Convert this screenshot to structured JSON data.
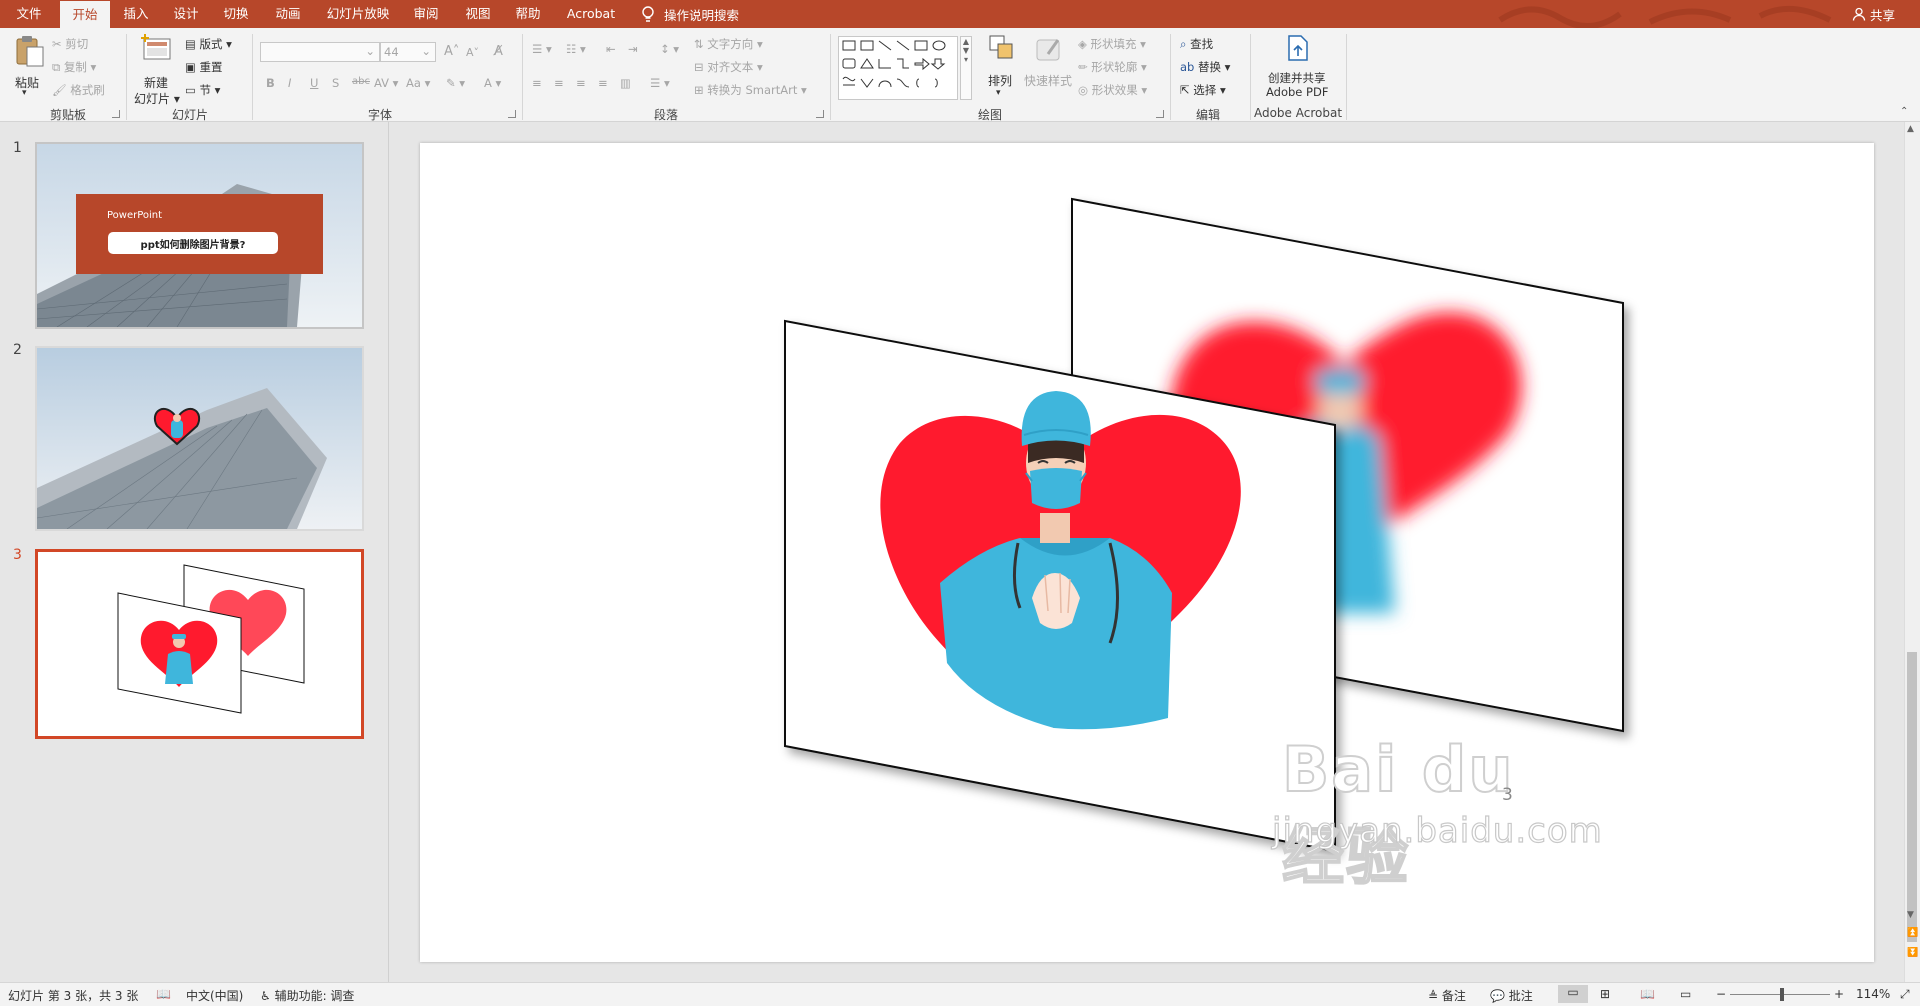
{
  "tabs": [
    "文件",
    "开始",
    "插入",
    "设计",
    "切换",
    "动画",
    "幻灯片放映",
    "审阅",
    "视图",
    "帮助",
    "Acrobat"
  ],
  "tell_me": "操作说明搜索",
  "share": "共享",
  "ribbon": {
    "clipboard": {
      "paste": "粘贴",
      "cut": "剪切",
      "copy": "复制",
      "format_painter": "格式刷",
      "label": "剪贴板"
    },
    "slides": {
      "new_slide": "新建",
      "new_slide2": "幻灯片",
      "layout": "版式",
      "reset": "重置",
      "section": "节",
      "label": "幻灯片"
    },
    "font": {
      "font_size": "44",
      "label": "字体"
    },
    "paragraph": {
      "text_direction": "文字方向",
      "align_text": "对齐文本",
      "smartart": "转换为 SmartArt",
      "label": "段落"
    },
    "drawing": {
      "arrange": "排列",
      "quick_styles": "快速样式",
      "shape_fill": "形状填充",
      "shape_outline": "形状轮廓",
      "shape_effects": "形状效果",
      "label": "绘图"
    },
    "editing": {
      "find": "查找",
      "replace": "替换",
      "select": "选择",
      "label": "编辑"
    },
    "acrobat": {
      "create_line1": "创建并共享",
      "create_line2": "Adobe PDF",
      "label": "Adobe Acrobat"
    }
  },
  "slides": [
    {
      "num": "1",
      "brand": "PowerPoint",
      "title": "ppt如何删除图片背景?"
    },
    {
      "num": "2"
    },
    {
      "num": "3"
    }
  ],
  "slide_page_number": "3",
  "watermark": {
    "logo": "Bai du 经验",
    "url": "jingyan.baidu.com"
  },
  "status": {
    "slide_info": "幻灯片 第 3 张，共 3 张",
    "language": "中文(中国)",
    "accessibility": "辅助功能: 调查",
    "notes": "备注",
    "comments": "批注",
    "zoom_minus": "−",
    "zoom_plus": "+",
    "zoom": "114%"
  },
  "colors": {
    "accent": "#b7472a",
    "selected_border": "#d24726",
    "heart": "#ff1a2e",
    "scrubs": "#3fb6dc"
  }
}
